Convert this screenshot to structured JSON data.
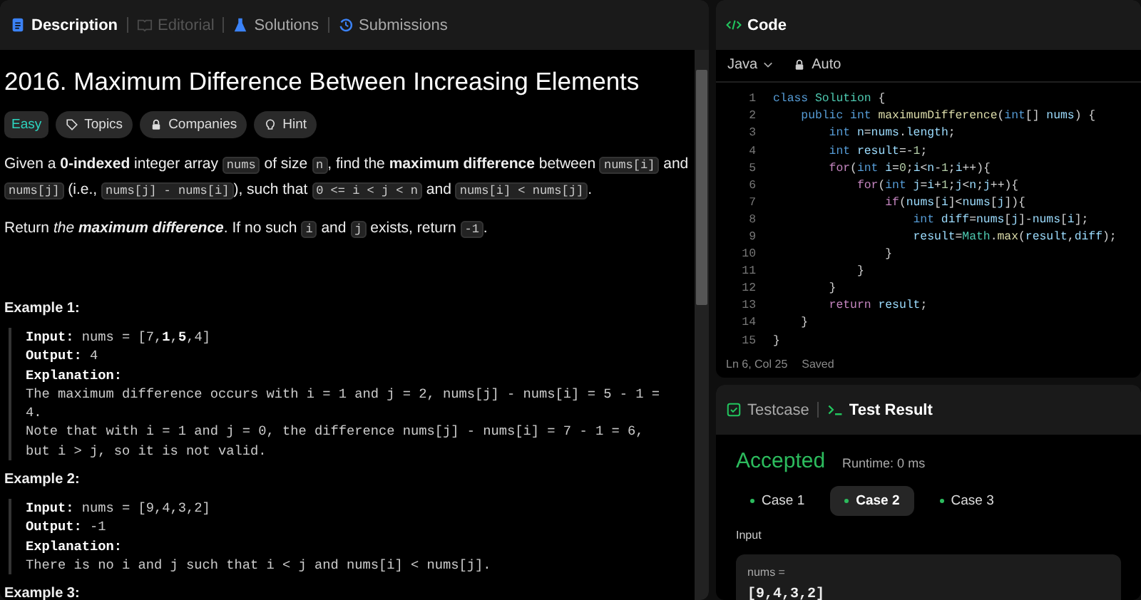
{
  "description_panel": {
    "tabs": [
      {
        "label": "Description",
        "selected": true,
        "disabled": false
      },
      {
        "label": "Editorial",
        "selected": false,
        "disabled": true
      },
      {
        "label": "Solutions",
        "selected": false,
        "disabled": false
      },
      {
        "label": "Submissions",
        "selected": false,
        "disabled": false
      }
    ],
    "title": "2016. Maximum Difference Between Increasing Elements",
    "tags": [
      {
        "label": "Easy",
        "kind": "difficulty"
      },
      {
        "label": "Topics",
        "kind": "tag"
      },
      {
        "label": "Companies",
        "kind": "lock"
      },
      {
        "label": "Hint",
        "kind": "bulb"
      }
    ],
    "paragraphs": [
      [
        {
          "kind": "text",
          "text": "Given a **0-indexed** integer array "
        },
        {
          "kind": "code",
          "text": "nums"
        },
        {
          "kind": "text",
          "text": " of size "
        },
        {
          "kind": "code",
          "text": "n"
        },
        {
          "kind": "text",
          "text": ", find the **maximum difference** between "
        },
        {
          "kind": "code",
          "text": "nums[i]"
        },
        {
          "kind": "text",
          "text": " and "
        },
        {
          "kind": "code",
          "text": "nums[j]"
        },
        {
          "kind": "text",
          "text": " (i.e., "
        },
        {
          "kind": "code",
          "text": "nums[j] - nums[i]"
        },
        {
          "kind": "text",
          "text": "), such that "
        },
        {
          "kind": "code",
          "text": "0 <= i < j < n"
        },
        {
          "kind": "text",
          "text": " and "
        },
        {
          "kind": "code",
          "text": "nums[i] < nums[j]"
        },
        {
          "kind": "text",
          "text": "."
        }
      ],
      [
        {
          "kind": "text",
          "text": "Return *the* "
        },
        {
          "kind": "emphasis",
          "text": "maximum difference"
        },
        {
          "kind": "text",
          "text": ". If no such "
        },
        {
          "kind": "code",
          "text": "i"
        },
        {
          "kind": "text",
          "text": " and "
        },
        {
          "kind": "code",
          "text": "j"
        },
        {
          "kind": "text",
          "text": " exists, return "
        },
        {
          "kind": "code",
          "text": "-1"
        },
        {
          "kind": "text",
          "text": "."
        }
      ]
    ],
    "examples": [
      {
        "heading": "Example 1:",
        "lines": [
          "**Input:** nums = [7,**1**,**5**,4]",
          "**Output:** 4",
          "**Explanation:**",
          "The maximum difference occurs with i = 1 and j = 2, nums[j] - nums[i] = 5 - 1 = 4.",
          "Note that with i = 1 and j = 0, the difference nums[j] - nums[i] = 7 - 1 = 6, but i > j, so it is not valid."
        ]
      },
      {
        "heading": "Example 2:",
        "lines": [
          "**Input:** nums = [9,4,3,2]",
          "**Output:** -1",
          "**Explanation:**",
          "There is no i and j such that i < j and nums[i] < nums[j]."
        ]
      },
      {
        "heading": "Example 3:"
      }
    ]
  },
  "code_panel": {
    "title": "Code",
    "language": "Java",
    "mode": "Auto",
    "lines": [
      {
        "number": "1",
        "tokens": [
          {
            "kind": "kw",
            "text": "class"
          },
          {
            "kind": "cls",
            "text": " Solution"
          },
          {
            "kind": "p",
            "text": " {"
          }
        ]
      },
      {
        "number": "2",
        "tokens": [
          {
            "kind": "kw",
            "text": "    public int"
          },
          {
            "kind": "fn",
            "text": " maximumDifference"
          },
          {
            "kind": "p",
            "text": "("
          },
          {
            "kind": "kw",
            "text": "int"
          },
          {
            "kind": "p",
            "text": "[] "
          },
          {
            "kind": "id",
            "text": "nums"
          },
          {
            "kind": "p",
            "text": ") {"
          }
        ]
      },
      {
        "number": "3",
        "tokens": [
          {
            "kind": "kw",
            "text": "        int"
          },
          {
            "kind": "id",
            "text": " n"
          },
          {
            "kind": "p",
            "text": "="
          },
          {
            "kind": "id",
            "text": "nums"
          },
          {
            "kind": "p",
            "text": "."
          },
          {
            "kind": "id",
            "text": "length"
          },
          {
            "kind": "p",
            "text": ";"
          }
        ]
      },
      {
        "number": "4",
        "tokens": [
          {
            "kind": "kw",
            "text": "        int"
          },
          {
            "kind": "id",
            "text": " result"
          },
          {
            "kind": "p",
            "text": "=-"
          },
          {
            "kind": "num",
            "text": "1"
          },
          {
            "kind": "p",
            "text": ";"
          }
        ]
      },
      {
        "number": "5",
        "tokens": [
          {
            "kind": "ctl",
            "text": "        for"
          },
          {
            "kind": "p",
            "text": "("
          },
          {
            "kind": "kw",
            "text": "int"
          },
          {
            "kind": "id",
            "text": " i"
          },
          {
            "kind": "p",
            "text": "="
          },
          {
            "kind": "num",
            "text": "0"
          },
          {
            "kind": "p",
            "text": ";"
          },
          {
            "kind": "id",
            "text": "i"
          },
          {
            "kind": "p",
            "text": "<"
          },
          {
            "kind": "id",
            "text": "n"
          },
          {
            "kind": "p",
            "text": "-"
          },
          {
            "kind": "num",
            "text": "1"
          },
          {
            "kind": "p",
            "text": ";"
          },
          {
            "kind": "id",
            "text": "i"
          },
          {
            "kind": "p",
            "text": "++){"
          }
        ]
      },
      {
        "number": "6",
        "tokens": [
          {
            "kind": "ctl",
            "text": "            for"
          },
          {
            "kind": "p",
            "text": "("
          },
          {
            "kind": "kw",
            "text": "int"
          },
          {
            "kind": "id",
            "text": " j"
          },
          {
            "kind": "p",
            "text": "="
          },
          {
            "kind": "id",
            "text": "i"
          },
          {
            "kind": "p",
            "text": "+"
          },
          {
            "kind": "num",
            "text": "1"
          },
          {
            "kind": "p",
            "text": ";"
          },
          {
            "kind": "id",
            "text": "j"
          },
          {
            "kind": "p",
            "text": "<"
          },
          {
            "kind": "id",
            "text": "n"
          },
          {
            "kind": "p",
            "text": ";"
          },
          {
            "kind": "id",
            "text": "j"
          },
          {
            "kind": "p",
            "text": "++){"
          }
        ]
      },
      {
        "number": "7",
        "tokens": [
          {
            "kind": "ctl",
            "text": "                if"
          },
          {
            "kind": "p",
            "text": "("
          },
          {
            "kind": "id",
            "text": "nums"
          },
          {
            "kind": "p",
            "text": "["
          },
          {
            "kind": "id",
            "text": "i"
          },
          {
            "kind": "p",
            "text": "]<"
          },
          {
            "kind": "id",
            "text": "nums"
          },
          {
            "kind": "p",
            "text": "["
          },
          {
            "kind": "id",
            "text": "j"
          },
          {
            "kind": "p",
            "text": "]){"
          }
        ]
      },
      {
        "number": "8",
        "tokens": [
          {
            "kind": "kw",
            "text": "                    int"
          },
          {
            "kind": "id",
            "text": " diff"
          },
          {
            "kind": "p",
            "text": "="
          },
          {
            "kind": "id",
            "text": "nums"
          },
          {
            "kind": "p",
            "text": "["
          },
          {
            "kind": "id",
            "text": "j"
          },
          {
            "kind": "p",
            "text": "]-"
          },
          {
            "kind": "id",
            "text": "nums"
          },
          {
            "kind": "p",
            "text": "["
          },
          {
            "kind": "id",
            "text": "i"
          },
          {
            "kind": "p",
            "text": "];"
          }
        ]
      },
      {
        "number": "9",
        "tokens": [
          {
            "kind": "id",
            "text": "                    result"
          },
          {
            "kind": "p",
            "text": "="
          },
          {
            "kind": "cls",
            "text": "Math"
          },
          {
            "kind": "p",
            "text": "."
          },
          {
            "kind": "fn",
            "text": "max"
          },
          {
            "kind": "p",
            "text": "("
          },
          {
            "kind": "id",
            "text": "result"
          },
          {
            "kind": "p",
            "text": ","
          },
          {
            "kind": "id",
            "text": "diff"
          },
          {
            "kind": "p",
            "text": ");"
          }
        ]
      },
      {
        "number": "10",
        "tokens": [
          {
            "kind": "p",
            "text": "                }"
          }
        ]
      },
      {
        "number": "11",
        "tokens": [
          {
            "kind": "p",
            "text": "            }"
          }
        ]
      },
      {
        "number": "12",
        "tokens": [
          {
            "kind": "p",
            "text": "        }"
          }
        ]
      },
      {
        "number": "13",
        "tokens": [
          {
            "kind": "ctl",
            "text": "        return"
          },
          {
            "kind": "id",
            "text": " result"
          },
          {
            "kind": "p",
            "text": ";"
          }
        ]
      },
      {
        "number": "14",
        "tokens": [
          {
            "kind": "p",
            "text": "    }"
          }
        ]
      },
      {
        "number": "15",
        "tokens": [
          {
            "kind": "p",
            "text": "}"
          }
        ]
      }
    ],
    "cursor": "Ln 6, Col 25",
    "save_state": "Saved"
  },
  "result_panel": {
    "tabs": [
      {
        "label": "Testcase",
        "selected": false
      },
      {
        "label": "Test Result",
        "selected": true
      }
    ],
    "status": "Accepted",
    "runtime": "Runtime: 0 ms",
    "cases": [
      {
        "label": "Case 1",
        "selected": false
      },
      {
        "label": "Case 2",
        "selected": true
      },
      {
        "label": "Case 3",
        "selected": false
      }
    ],
    "input_label": "Input",
    "input_name": "nums =",
    "input_value": "[9,4,3,2]"
  }
}
